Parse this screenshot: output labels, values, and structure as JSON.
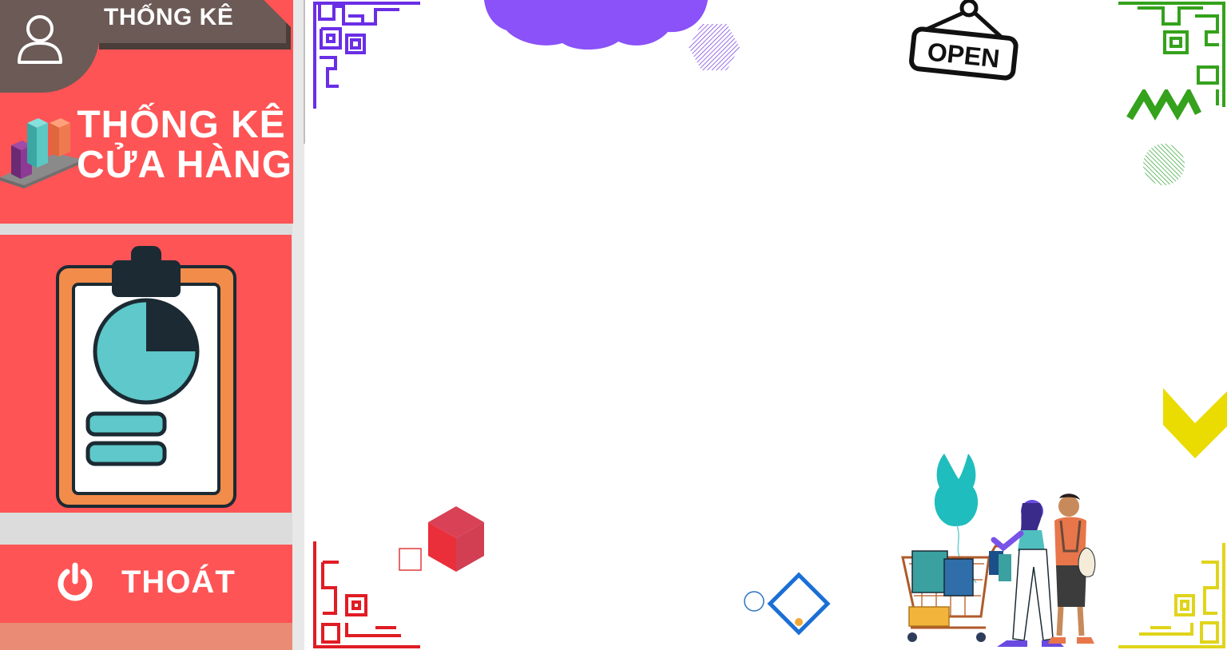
{
  "header": {
    "tab_label": "THỐNG KÊ"
  },
  "sidebar": {
    "title_line1": "THỐNG KÊ",
    "title_line2": "CỬA HÀNG",
    "exit_label": "THOÁT",
    "user_icon": "user-icon",
    "chart_icon": "bar-chart-3d-icon",
    "report_icon": "clipboard-pie-report-icon",
    "power_icon": "power-icon"
  },
  "decor": {
    "open_sign": "OPEN"
  },
  "colors": {
    "sidebar_red": "#fe5455",
    "header_tab": "#6b5a56",
    "exit_bottom": "#e98b75",
    "purple_cloud": "#8a52f8",
    "frame_purple": "#6a2ee6",
    "frame_green": "#34a21c",
    "frame_red": "#e01c24",
    "frame_yellow": "#e0d41a"
  }
}
